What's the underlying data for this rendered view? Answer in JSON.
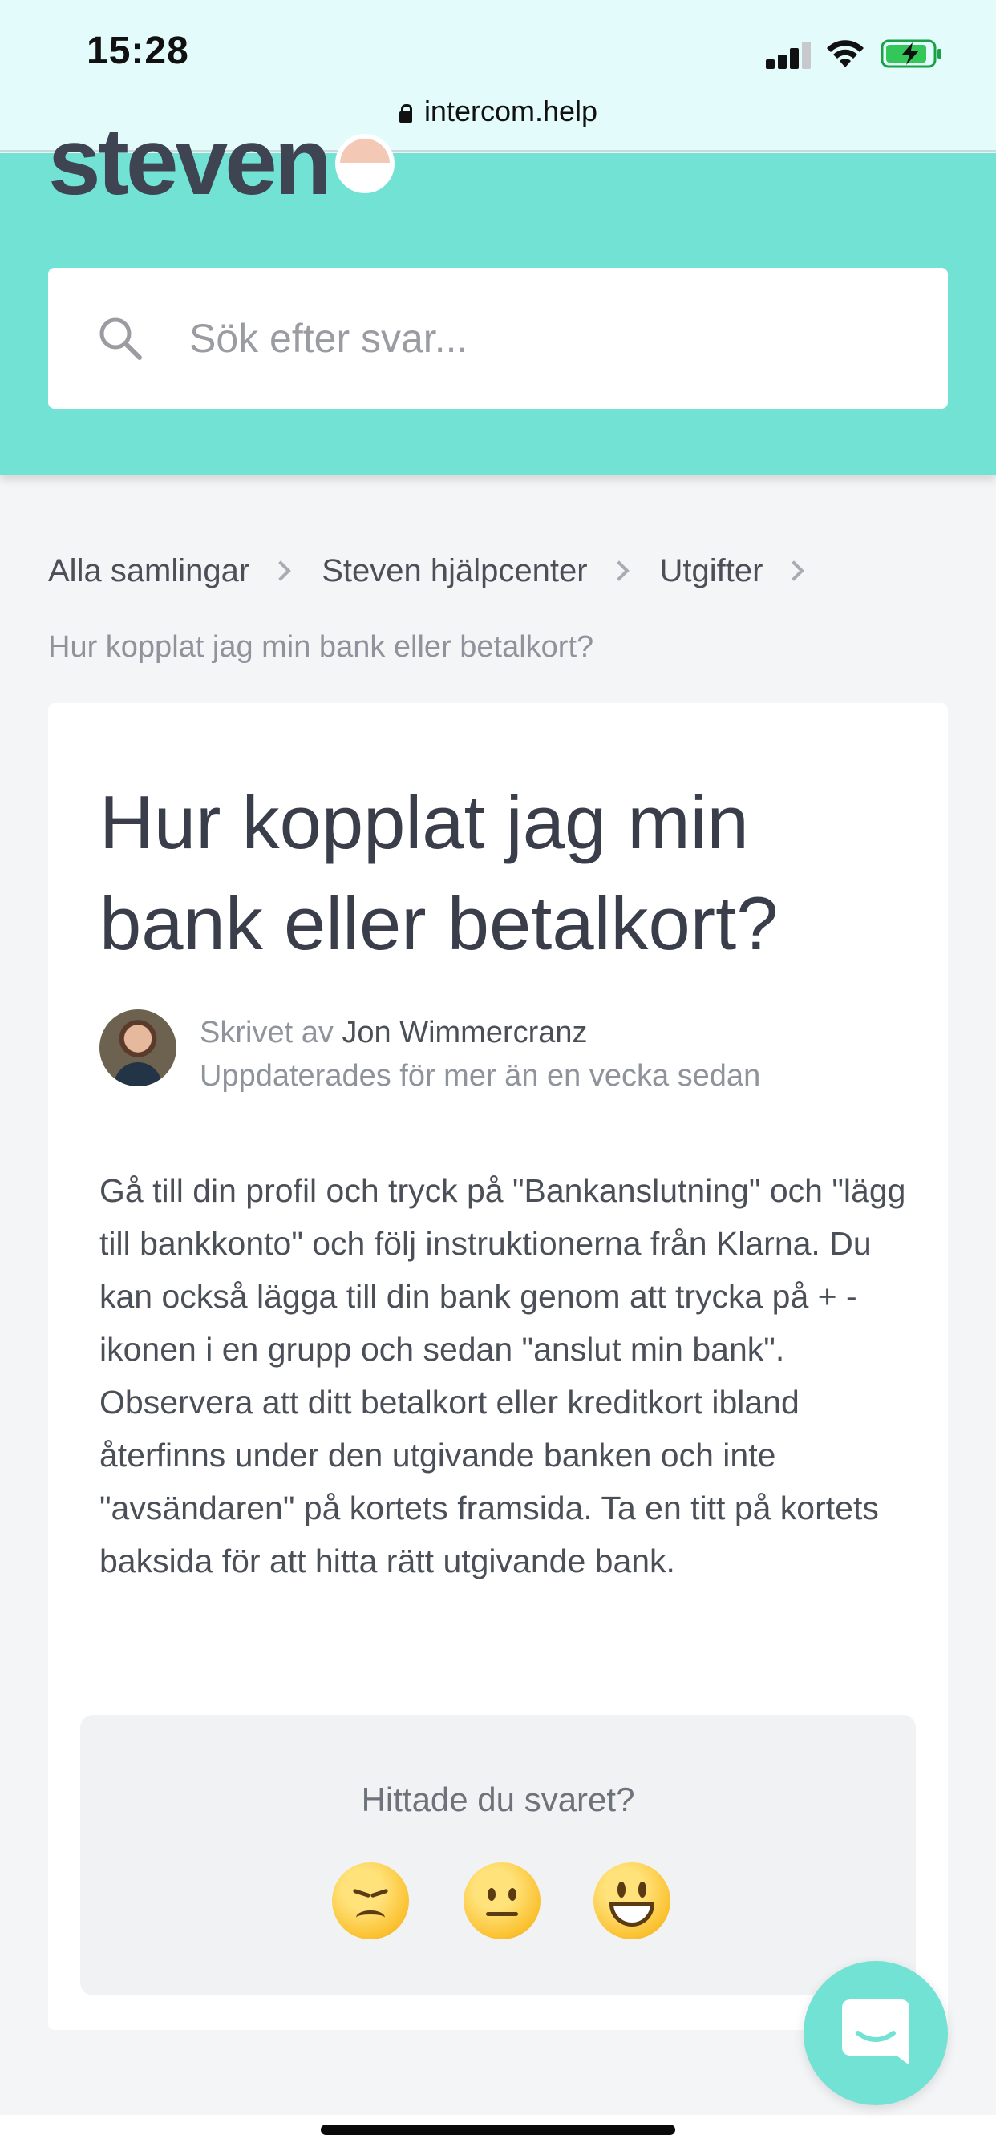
{
  "status_bar": {
    "time": "15:28",
    "url": "intercom.help",
    "icons": [
      "signal-icon",
      "wifi-icon",
      "battery-charging-icon",
      "lock-icon"
    ]
  },
  "header": {
    "logo_text": "steven",
    "brand_color": "#72e2d4",
    "search": {
      "placeholder": "Sök efter svar..."
    }
  },
  "breadcrumb": {
    "items": [
      "Alla samlingar",
      "Steven hjälpcenter",
      "Utgifter"
    ],
    "current": "Hur kopplat jag min bank eller betalkort?"
  },
  "article": {
    "title": "Hur kopplat jag min bank eller betalkort?",
    "written_by_prefix": "Skrivet av",
    "author": "Jon Wimmercranz",
    "updated": "Uppdaterades för mer än en vecka sedan",
    "body": "Gå till din profil och tryck på \"Bankanslutning\" och \"lägg till bankkonto\" och följ instruktionerna från Klarna. Du kan också lägga till din bank genom att trycka på + -ikonen i en grupp och sedan \"anslut min bank\". Observera att ditt betalkort eller kreditkort ibland återfinns under den utgivande banken och inte \"avsändaren\" på kortets framsida. Ta en titt på kortets baksida för att hitta rätt utgivande bank."
  },
  "feedback": {
    "question": "Hittade du svaret?",
    "options": [
      "disappointed-emoji",
      "neutral-emoji",
      "smiley-emoji"
    ]
  },
  "messenger": {
    "icon": "chat-icon"
  }
}
